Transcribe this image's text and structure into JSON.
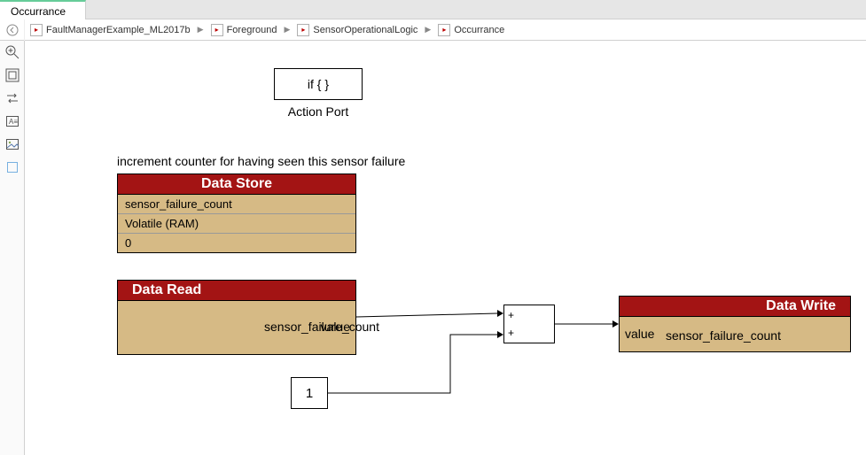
{
  "tab": {
    "title": "Occurrance"
  },
  "breadcrumbs": [
    {
      "label": "FaultManagerExample_ML2017b"
    },
    {
      "label": "Foreground"
    },
    {
      "label": "SensorOperationalLogic"
    },
    {
      "label": "Occurrance"
    }
  ],
  "action_port": {
    "content": "if { }",
    "label": "Action Port"
  },
  "comment": "increment counter for having seen this sensor failure",
  "data_store": {
    "title": "Data Store",
    "signal": "sensor_failure_count",
    "storage": "Volatile (RAM)",
    "initial": "0"
  },
  "data_read": {
    "title": "Data Read",
    "signal": "sensor_failure_count",
    "port": "value"
  },
  "constant": {
    "value": "1"
  },
  "sum": {
    "p1": "+",
    "p2": "+"
  },
  "data_write": {
    "title": "Data Write",
    "port": "value",
    "signal": "sensor_failure_count"
  }
}
